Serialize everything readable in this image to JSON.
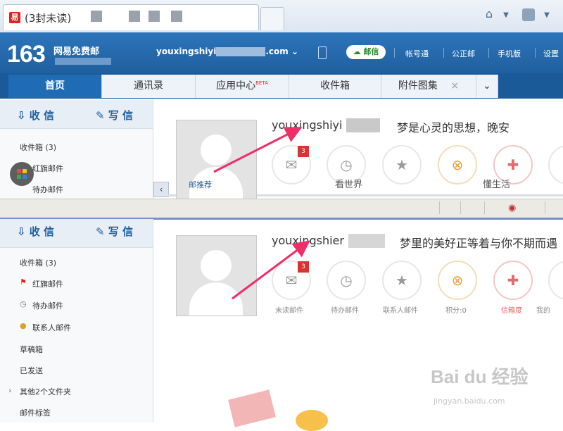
{
  "browser": {
    "tab_title": "(3封未读)",
    "toolbar_icons": [
      "home-icon",
      "dropdown-icon",
      "rss-icon",
      "dropdown-icon"
    ]
  },
  "header": {
    "logo_number": "163",
    "logo_text": "网易免费邮",
    "account_prefix": "youxingshiyi",
    "account_suffix": ".com",
    "app_button": "邮信",
    "links": [
      "帐号通",
      "公正邮",
      "手机版",
      "设置"
    ]
  },
  "nav_tabs": [
    {
      "label": "首页",
      "active": true
    },
    {
      "label": "通讯录"
    },
    {
      "label": "应用中心",
      "badge": "BETA"
    },
    {
      "label": "收件箱"
    },
    {
      "label": "附件图集",
      "close": "×"
    },
    {
      "label": "⌄"
    }
  ],
  "top_pane": {
    "compose": {
      "receive": "收 信",
      "write": "写 信"
    },
    "sidebar_items": [
      "收件箱 (3)",
      "红旗邮件",
      "待办邮件"
    ],
    "username": "youxingshiyi",
    "motto": "梦是心灵的思想，晚安",
    "mail_badge": "3",
    "labels": [
      "邮推荐",
      "看世界",
      "懂生活"
    ]
  },
  "bottom_pane": {
    "compose": {
      "receive": "收 信",
      "write": "写 信"
    },
    "sidebar_items": [
      "收件箱 (3)",
      "红旗邮件",
      "待办邮件",
      "联系人邮件",
      "草稿箱",
      "已发送",
      "其他2个文件夹",
      "邮件标签"
    ],
    "username": "youxingshier",
    "motto": "梦里的美好正等着与你不期而遇",
    "mail_badge": "3",
    "shortcut_labels": [
      "未读邮件",
      "待办邮件",
      "联系人邮件",
      "积分:0",
      "信箱度",
      "我的"
    ]
  },
  "watermark": {
    "text": "Bai du 经验",
    "sub": "jingyan.baidu.com"
  },
  "colors": {
    "header_blue": "#2d75bb",
    "badge_red": "#d93333",
    "arrow_pink": "#ef2e67"
  }
}
